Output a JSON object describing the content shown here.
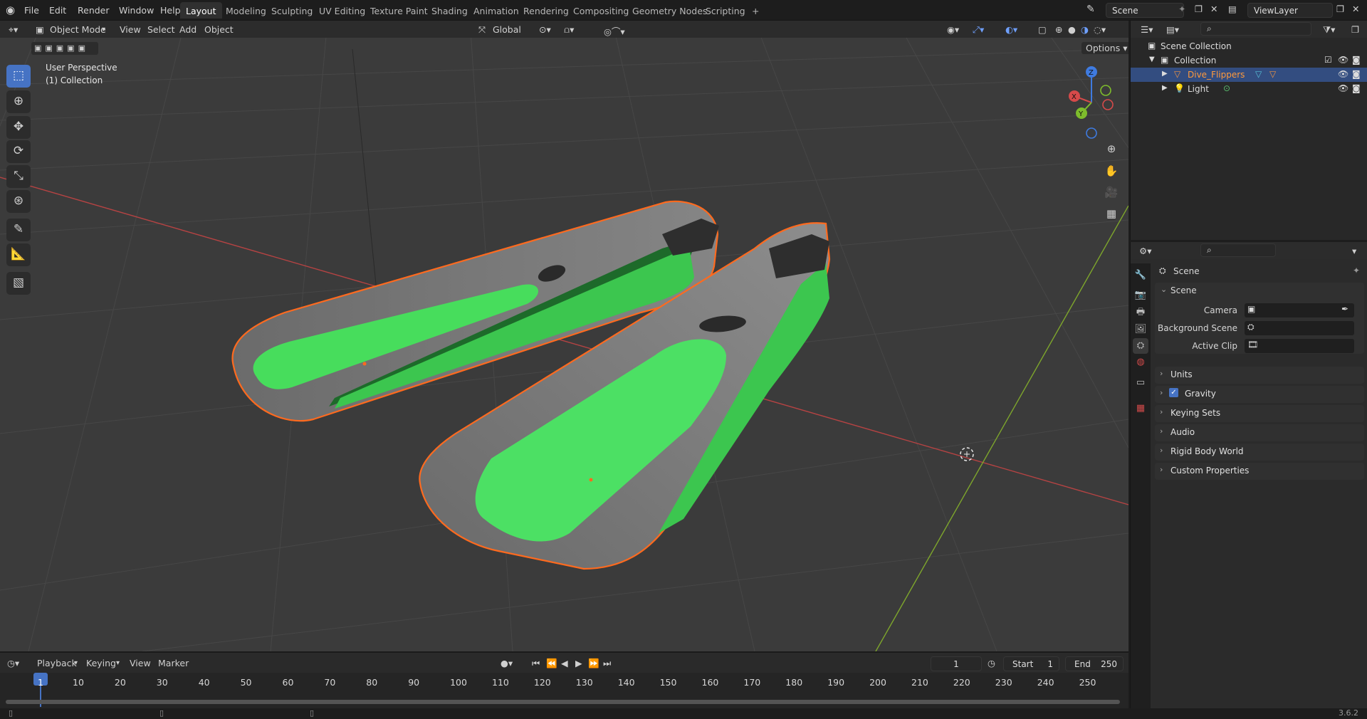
{
  "topbar": {
    "menus": [
      "File",
      "Edit",
      "Render",
      "Window",
      "Help"
    ],
    "workspaces": [
      "Layout",
      "Modeling",
      "Sculpting",
      "UV Editing",
      "Texture Paint",
      "Shading",
      "Animation",
      "Rendering",
      "Compositing",
      "Geometry Nodes",
      "Scripting"
    ],
    "active_workspace": "Layout",
    "add_tab": "+",
    "scene": "Scene",
    "view_layer": "ViewLayer"
  },
  "viewport": {
    "mode": "Object Mode",
    "menus": [
      "View",
      "Select",
      "Add",
      "Object"
    ],
    "orientation": "Global",
    "options": "Options",
    "overlay_title": "User Perspective",
    "overlay_collection": "(1) Collection",
    "gizmo_axes": {
      "x": "X",
      "y": "Y",
      "z": "Z"
    },
    "colors": {
      "background": "#3b3b3b",
      "fin_gray": "#7c7c7c",
      "fin_green": "#3ed654",
      "selection_outline": "#ff6a1e",
      "x_axis": "#b54343",
      "y_axis": "#7ea62c"
    }
  },
  "timeline": {
    "menus": [
      "Playback",
      "Keying",
      "View",
      "Marker"
    ],
    "current_frame": "1",
    "start_label": "Start",
    "start": "1",
    "end_label": "End",
    "end": "250",
    "frame_marks": [
      "1",
      "10",
      "20",
      "30",
      "40",
      "50",
      "60",
      "70",
      "80",
      "90",
      "100",
      "110",
      "120",
      "130",
      "140",
      "150",
      "160",
      "170",
      "180",
      "190",
      "200",
      "210",
      "220",
      "230",
      "240",
      "250"
    ]
  },
  "status": {
    "version": "3.6.2"
  },
  "outliner": {
    "items": [
      {
        "label": "Scene Collection",
        "icon": "scene-collection-icon"
      },
      {
        "label": "Collection",
        "icon": "collection-icon"
      },
      {
        "label": "Dive_Flippers",
        "icon": "mesh-object-icon",
        "selected": true
      },
      {
        "label": "Light",
        "icon": "light-icon"
      }
    ]
  },
  "properties": {
    "context": "Scene",
    "panel_scene": "Scene",
    "fields": [
      {
        "label": "Camera"
      },
      {
        "label": "Background Scene"
      },
      {
        "label": "Active Clip"
      }
    ],
    "subpanels": [
      "Units",
      "Gravity",
      "Keying Sets",
      "Audio",
      "Rigid Body World",
      "Custom Properties"
    ],
    "gravity_enabled": true
  }
}
